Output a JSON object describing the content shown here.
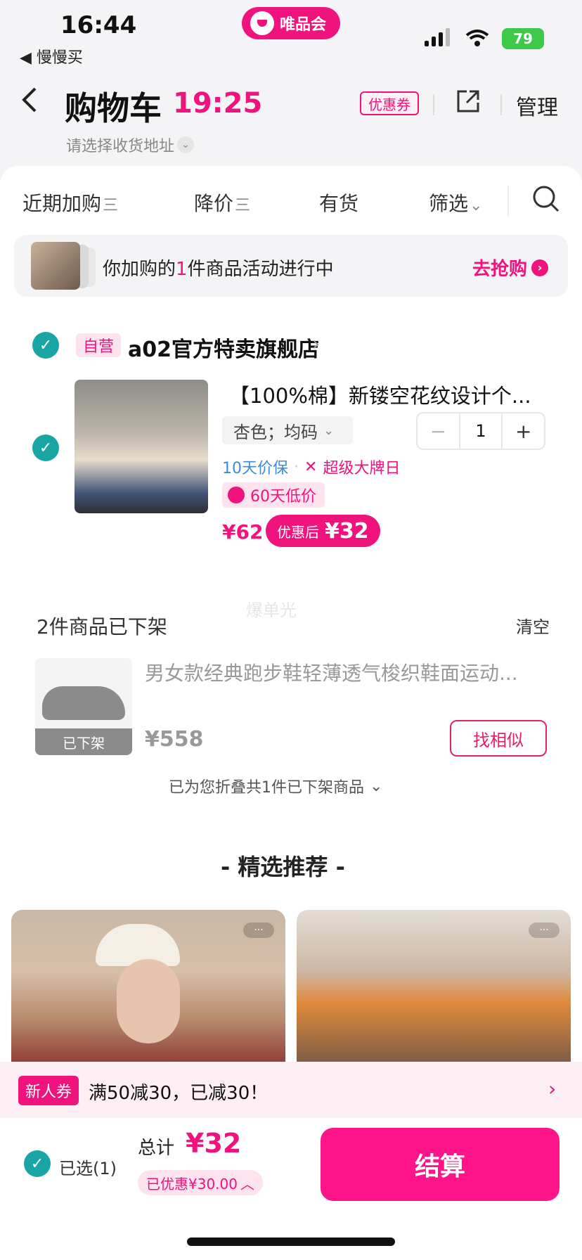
{
  "status_bar": {
    "time": "16:44",
    "back_app": "◀ 慢慢买",
    "brand": "唯品会",
    "battery": "79"
  },
  "header": {
    "back_icon": "chevron-left-icon",
    "title": "购物车",
    "timer": "19:25",
    "coupon": "优惠券",
    "manage": "管理",
    "address": "请选择收货地址"
  },
  "filters": {
    "tabs": [
      {
        "label": "近期加购",
        "suffix": "三"
      },
      {
        "label": "降价",
        "suffix": "三"
      },
      {
        "label": "有货",
        "suffix": ""
      },
      {
        "label": "筛选",
        "suffix": "⌄"
      }
    ]
  },
  "promo": {
    "text_pre": "你加购的",
    "count": "1",
    "text_post": "件商品活动进行中",
    "action": "去抢购"
  },
  "store": {
    "self_tag": "自营",
    "name": "a02官方特卖旗舰店",
    "item": {
      "title": "【100%棉】新镂空花纹设计个...",
      "sku": "杏色；均码",
      "quantity": "1",
      "tag_price_protect": "10天价保",
      "tag_brand_day": "超级大牌日",
      "low_price": "60天低价",
      "price": "¥62",
      "after_label": "优惠后",
      "after_value": "¥32"
    }
  },
  "off_shelf": {
    "title": "2件商品已下架",
    "clear": "清空",
    "watermark": "爆单光",
    "item": {
      "name": "男女款经典跑步鞋轻薄透气梭织鞋面运动...",
      "status": "已下架",
      "price": "¥558",
      "similar": "找相似"
    },
    "fold_text": "已为您折叠共1件已下架商品"
  },
  "recommend": {
    "title": "- 精选推荐 -",
    "more": "···"
  },
  "coupon_bar": {
    "badge": "新人券",
    "text": "满50减30，已减30！"
  },
  "bottom": {
    "selected": "已选(1)",
    "total_label": "总计",
    "total_value": "¥32",
    "saved": "已优惠¥30.00",
    "checkout": "结算"
  },
  "colors": {
    "accent": "#f0127d",
    "check": "#1aa5a5",
    "checkout": "#ff1489"
  }
}
